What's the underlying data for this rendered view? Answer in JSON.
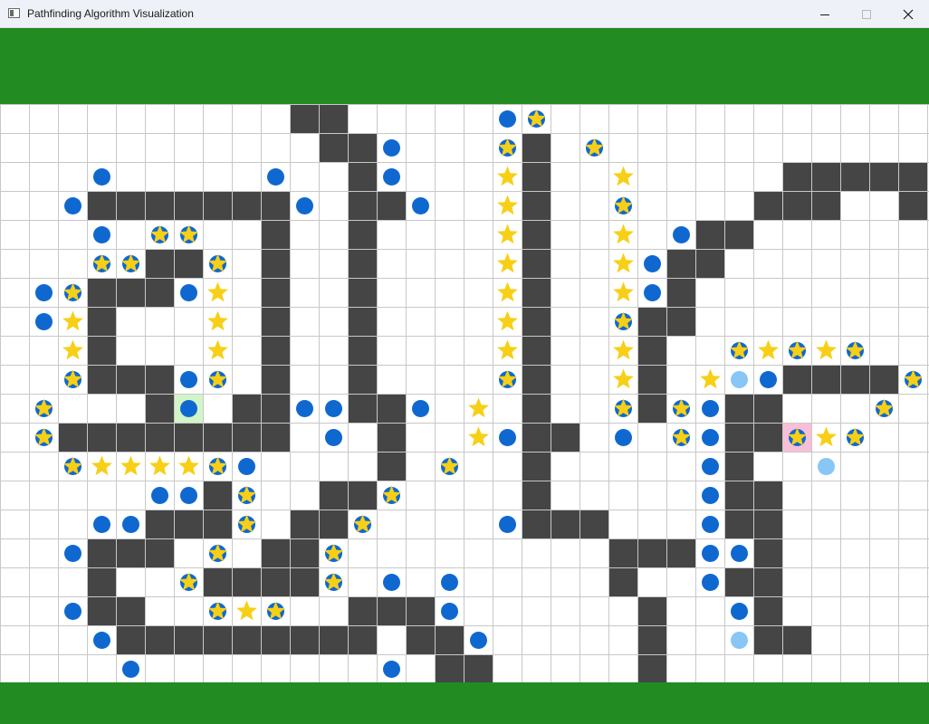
{
  "window": {
    "title": "Pathfinding Algorithm Visualization",
    "controls": [
      "minimize",
      "maximize",
      "close"
    ]
  },
  "colors": {
    "banner": "#228b22",
    "wall": "#454545",
    "grid_line": "#c8c8c8",
    "cell": "#ffffff",
    "explored_node": "#0f68d0",
    "frontier_node": "#87c6f5",
    "path_star": "#f7cf16",
    "start_cell": "#d2f5c8",
    "goal_cell": "#f8bfd8"
  },
  "grid": {
    "cols": 32,
    "rows": 20,
    "legend": {
      "#": "wall",
      "o": "explored-node",
      "c": "frontier-node",
      "*": "path-star",
      "@": "path-star-outlined",
      "S": "start-cell",
      "G": "goal-cell",
      ".": "empty"
    },
    "rows_map": [
      "..........##.....o@.............",
      "...........##o...@#.@...........",
      "...o.....o..#o...*#..*.....#####",
      "..o#######o.##o..*#..@....###..#",
      "...o.@@..#..#....*#..*.o##......",
      "...@@##@.#..#....*#..*o##.......",
      ".o@###o*.#..#....*#..*o#........",
      ".o*#...*.#..#....*#..@##........",
      "..*#...*.#..#....*#..*#..@*@*@..",
      "..@###o@.#..#....@#..*#.*co####@",
      ".@...#S.##oo##o.*.#..@#@o##...@.",
      ".@########.o.#..*o##.o.@o##G*@..",
      "..@****@o....#.@..#.....o#..c...",
      ".....oo#@..##@....#.....o##.....",
      "...oo###@.##@....o###...o##.....",
      "..o###.@.##@.........###oo#.....",
      "...#..@####@.o.o.....#..o##.....",
      "..o##..@*@..###o......#..o#.....",
      "...o#########.##o.....#..c##....",
      "....o........o.##.....#........."
    ]
  }
}
